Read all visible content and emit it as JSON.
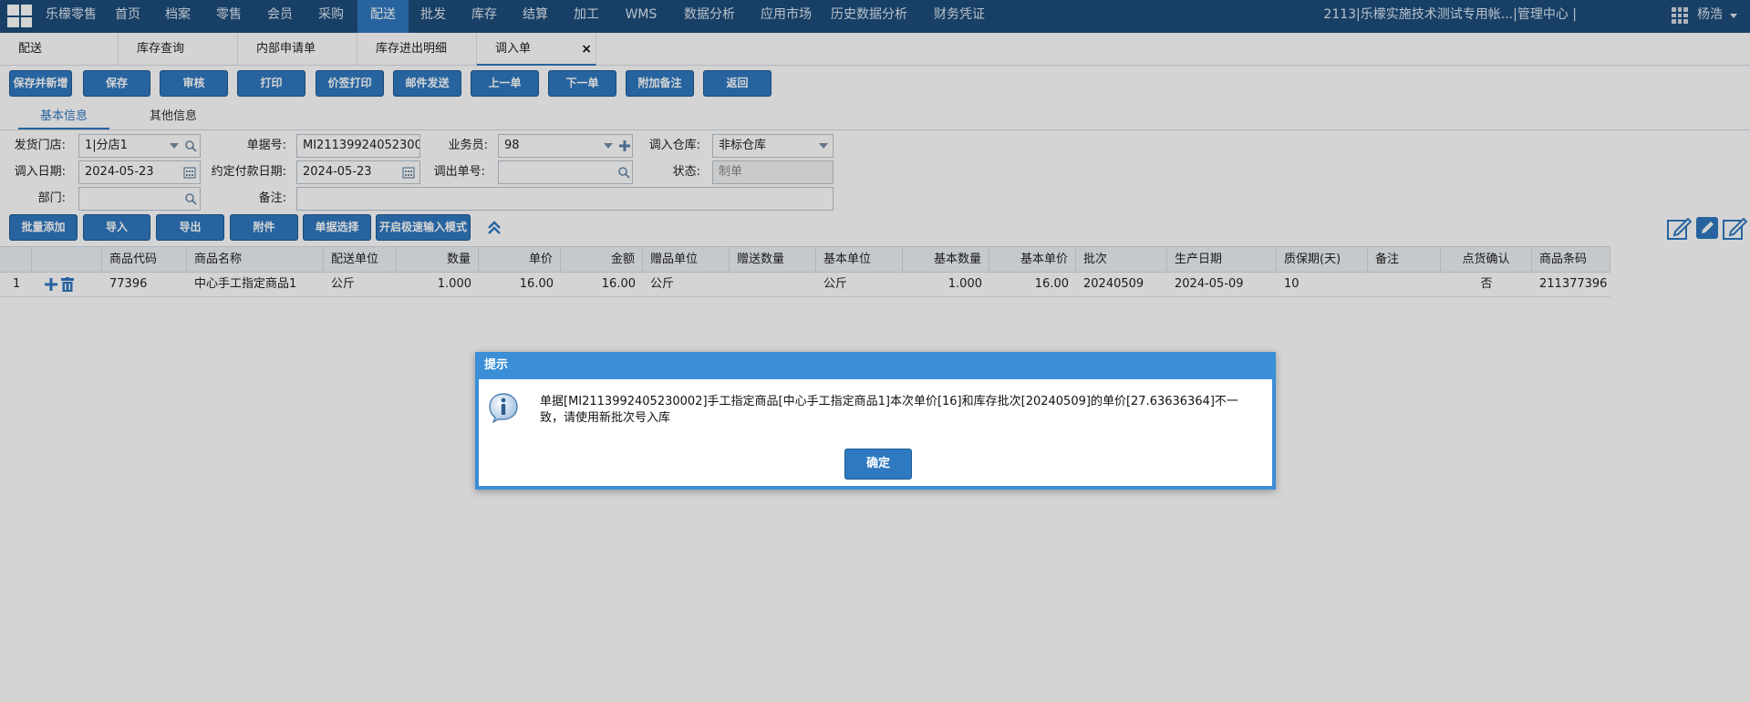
{
  "topnav": {
    "brand": "乐檬零售",
    "items": [
      "首页",
      "档案",
      "零售",
      "会员",
      "采购",
      "配送",
      "批发",
      "库存",
      "结算",
      "加工",
      "WMS",
      "数据分析",
      "应用市场",
      "历史数据分析",
      "财务凭证"
    ],
    "active": "配送",
    "account": "2113|乐檬实施技术测试专用帐...|管理中心 |",
    "user": "杨浩"
  },
  "pagetabs": [
    "配送",
    "库存查询",
    "内部申请单",
    "库存进出明细",
    "调入单"
  ],
  "pagetab_close": "×",
  "toolbar": [
    "保存并新增",
    "保存",
    "审核",
    "打印",
    "价签打印",
    "邮件发送",
    "上一单",
    "下一单",
    "附加备注",
    "返回"
  ],
  "infotabs": [
    "基本信息",
    "其他信息"
  ],
  "form": {
    "store_label": "发货门店:",
    "store_value": "1|分店1",
    "docno_label": "单据号:",
    "docno_value": "MI2113992405230002",
    "salesman_label": "业务员:",
    "salesman_value": "98",
    "warehouse_label": "调入仓库:",
    "warehouse_value": "非标仓库",
    "indate_label": "调入日期:",
    "indate_value": "2024-05-23",
    "paydate_label": "约定付款日期:",
    "paydate_value": "2024-05-23",
    "outdoc_label": "调出单号:",
    "outdoc_value": "",
    "status_label": "状态:",
    "status_value": "制单",
    "dept_label": "部门:",
    "dept_value": "",
    "remark_label": "备注:",
    "remark_value": ""
  },
  "actions": [
    "批量添加",
    "导入",
    "导出",
    "附件",
    "单据选择",
    "开启极速输入模式"
  ],
  "table": {
    "columns": [
      "商品代码",
      "商品名称",
      "配送单位",
      "数量",
      "单价",
      "金额",
      "赠品单位",
      "赠送数量",
      "基本单位",
      "基本数量",
      "基本单价",
      "批次",
      "生产日期",
      "质保期(天)",
      "备注",
      "点货确认",
      "商品条码"
    ],
    "rows": [
      [
        "1",
        "77396",
        "中心手工指定商品1",
        "公斤",
        "1.000",
        "16.00",
        "16.00",
        "公斤",
        "",
        "公斤",
        "1.000",
        "16.00",
        "20240509",
        "2024-05-09",
        "10",
        "",
        "否",
        "211377396"
      ]
    ]
  },
  "dialog": {
    "title": "提示",
    "message": "单据[MI2113992405230002]手工指定商品[中心手工指定商品1]本次单价[16]和库存批次[20240509]的单价[27.63636364]不一致，请使用新批次号入库",
    "ok": "确定"
  },
  "colors": {
    "nav_bg": "#1e4e7c",
    "accent": "#2f79c0",
    "dialog_border": "#3a8fd6"
  }
}
